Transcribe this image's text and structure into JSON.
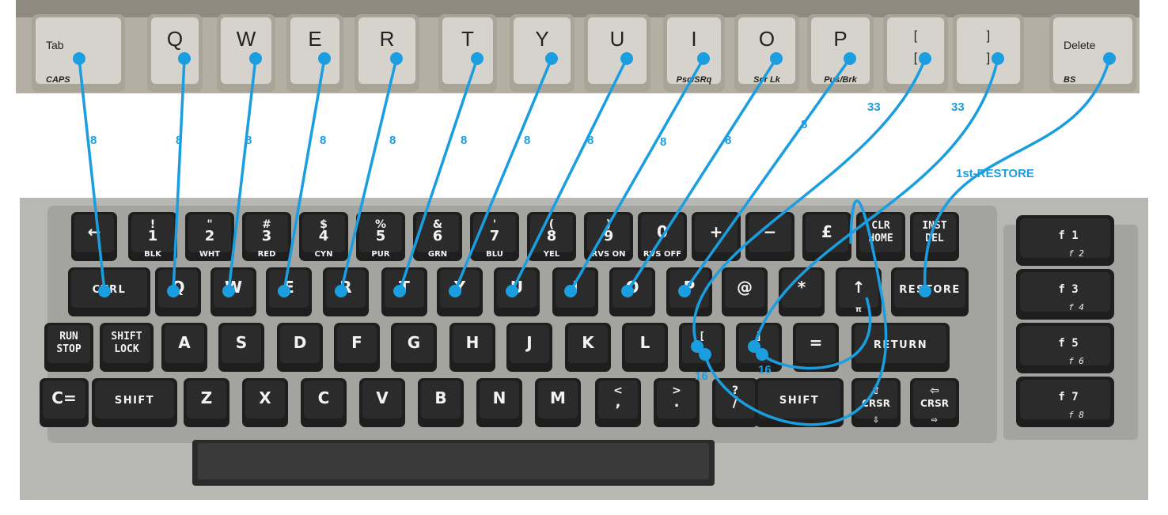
{
  "colors": {
    "accent": "#1a9ee0",
    "pc_key": "#d6d3cc",
    "pc_key_text": "#222222",
    "c64_key": "#2b2b2b",
    "c64_key_text": "#f2f2f2",
    "c64_case": "#b7b8b4",
    "c64_case_edge": "#9c9d99",
    "pc_case": "#b4afa2"
  },
  "pc_keys": [
    {
      "top": "Tab",
      "bottom": "CAPS"
    },
    {
      "top": "Q",
      "bottom": ""
    },
    {
      "top": "W",
      "bottom": ""
    },
    {
      "top": "E",
      "bottom": ""
    },
    {
      "top": "R",
      "bottom": ""
    },
    {
      "top": "T",
      "bottom": ""
    },
    {
      "top": "Y",
      "bottom": ""
    },
    {
      "top": "U",
      "bottom": ""
    },
    {
      "top": "I",
      "bottom": "Psc/SRq"
    },
    {
      "top": "O",
      "bottom": "Scr Lk"
    },
    {
      "top": "P",
      "bottom": "Pus/Brk"
    },
    {
      "top": "[",
      "top2": "[",
      "bottom": "↑"
    },
    {
      "top": "]",
      "top2": "]",
      "bottom": ""
    },
    {
      "top": "Delete",
      "bottom": "BS"
    }
  ],
  "c64_rows": [
    [
      {
        "main": "←",
        "sub": ""
      },
      {
        "top": "!",
        "main": "1",
        "sub": "BLK"
      },
      {
        "top": "\"",
        "main": "2",
        "sub": "WHT"
      },
      {
        "top": "#",
        "main": "3",
        "sub": "RED"
      },
      {
        "top": "$",
        "main": "4",
        "sub": "CYN"
      },
      {
        "top": "%",
        "main": "5",
        "sub": "PUR"
      },
      {
        "top": "&",
        "main": "6",
        "sub": "GRN"
      },
      {
        "top": "'",
        "main": "7",
        "sub": "BLU"
      },
      {
        "top": "(",
        "main": "8",
        "sub": "YEL"
      },
      {
        "top": ")",
        "main": "9",
        "sub": "RVS ON"
      },
      {
        "main": "0",
        "sub": "RVS OFF"
      },
      {
        "main": "+",
        "sub": ""
      },
      {
        "main": "−",
        "sub": ""
      },
      {
        "main": "£",
        "sub": ""
      },
      {
        "main": "CLR",
        "main2": "HOME",
        "sub": ""
      },
      {
        "main": "INST",
        "main2": "DEL",
        "sub": ""
      }
    ],
    [
      {
        "main": "CTRL",
        "sub": ""
      },
      {
        "main": "Q",
        "sub": ""
      },
      {
        "main": "W",
        "sub": ""
      },
      {
        "main": "E",
        "sub": ""
      },
      {
        "main": "R",
        "sub": ""
      },
      {
        "main": "T",
        "sub": ""
      },
      {
        "main": "Y",
        "sub": ""
      },
      {
        "main": "U",
        "sub": ""
      },
      {
        "main": "I",
        "sub": ""
      },
      {
        "main": "O",
        "sub": ""
      },
      {
        "main": "P",
        "sub": ""
      },
      {
        "main": "@",
        "sub": ""
      },
      {
        "main": "*",
        "sub": ""
      },
      {
        "main": "↑",
        "sub": "π"
      },
      {
        "main": "RESTORE",
        "sub": ""
      }
    ],
    [
      {
        "main": "RUN",
        "main2": "STOP",
        "sub": ""
      },
      {
        "main": "SHIFT",
        "main2": "LOCK",
        "sub": ""
      },
      {
        "main": "A",
        "sub": ""
      },
      {
        "main": "S",
        "sub": ""
      },
      {
        "main": "D",
        "sub": ""
      },
      {
        "main": "F",
        "sub": ""
      },
      {
        "main": "G",
        "sub": ""
      },
      {
        "main": "H",
        "sub": ""
      },
      {
        "main": "J",
        "sub": ""
      },
      {
        "main": "K",
        "sub": ""
      },
      {
        "main": "L",
        "sub": ""
      },
      {
        "main": "[",
        "main2": ":",
        "sub": ""
      },
      {
        "main": "]",
        "main2": ";",
        "sub": ""
      },
      {
        "main": "=",
        "sub": ""
      },
      {
        "main": "RETURN",
        "sub": ""
      }
    ],
    [
      {
        "main": "C=",
        "sub": ""
      },
      {
        "main": "SHIFT",
        "sub": ""
      },
      {
        "main": "Z",
        "sub": ""
      },
      {
        "main": "X",
        "sub": ""
      },
      {
        "main": "C",
        "sub": ""
      },
      {
        "main": "V",
        "sub": ""
      },
      {
        "main": "B",
        "sub": ""
      },
      {
        "main": "N",
        "sub": ""
      },
      {
        "main": "M",
        "sub": ""
      },
      {
        "top": "<",
        "main": ",",
        "sub": ""
      },
      {
        "top": ">",
        "main": ".",
        "sub": ""
      },
      {
        "top": "?",
        "main": "/",
        "sub": ""
      },
      {
        "main": "SHIFT",
        "sub": ""
      },
      {
        "top": "⇧",
        "main": "CRSR",
        "sub": "⇩"
      },
      {
        "top": "⇦",
        "main": "CRSR",
        "sub": "⇨"
      }
    ]
  ],
  "fkeys": [
    {
      "main": "f 1",
      "sub": "f 2"
    },
    {
      "main": "f 3",
      "sub": "f 4"
    },
    {
      "main": "f 5",
      "sub": "f 6"
    },
    {
      "main": "f 7",
      "sub": "f 8"
    }
  ],
  "links": [
    {
      "pc": 0,
      "c64": "CTRL",
      "label": "8"
    },
    {
      "pc": 1,
      "c64": "Q",
      "label": "8"
    },
    {
      "pc": 2,
      "c64": "W",
      "label": "8"
    },
    {
      "pc": 3,
      "c64": "E",
      "label": "8"
    },
    {
      "pc": 4,
      "c64": "R",
      "label": "8"
    },
    {
      "pc": 5,
      "c64": "T",
      "label": "8"
    },
    {
      "pc": 6,
      "c64": "Y",
      "label": "8"
    },
    {
      "pc": 7,
      "c64": "U",
      "label": "8"
    },
    {
      "pc": 8,
      "c64": "I",
      "label": "8"
    },
    {
      "pc": 9,
      "c64": "O",
      "label": "8"
    },
    {
      "pc": 10,
      "c64": "P",
      "label": "8"
    },
    {
      "pc": 11,
      "c64": ":",
      "label": "33"
    },
    {
      "pc": 12,
      "c64": ";",
      "label": "33"
    },
    {
      "pc": 13,
      "c64": "RESTORE",
      "label": "1st-RESTORE"
    }
  ],
  "extra_labels": [
    "16",
    "16"
  ]
}
